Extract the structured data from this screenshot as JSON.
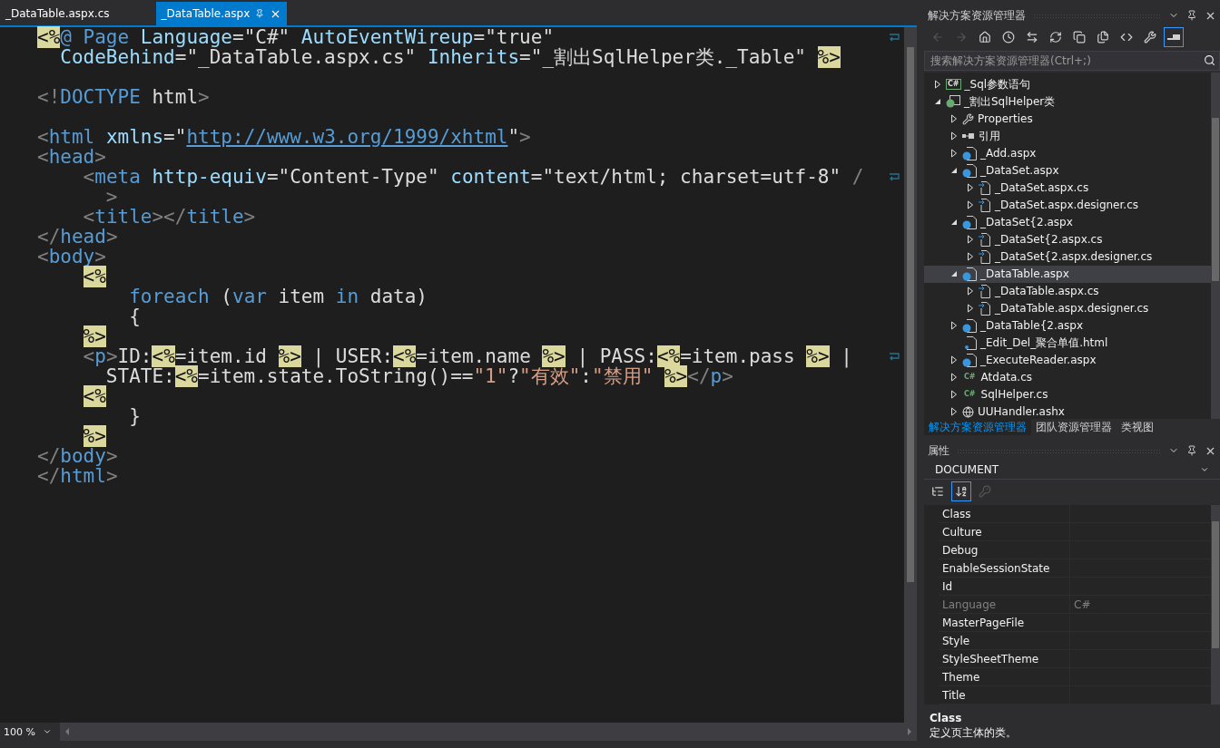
{
  "editor_tabs": [
    {
      "label": "_DataTable.aspx.cs",
      "selected": false
    },
    {
      "label": "_DataTable.aspx",
      "selected": true
    }
  ],
  "code_lines": [
    {
      "wrap": true,
      "tokens": [
        {
          "kind": "asp",
          "text": "<%"
        },
        {
          "kind": "tag",
          "text": "@ Page"
        },
        {
          "kind": "attr",
          "text": " Language"
        },
        {
          "kind": "plain",
          "text": "="
        },
        {
          "kind": "value",
          "text": "\"C#\""
        },
        {
          "kind": "attr",
          "text": " AutoEventWireup"
        },
        {
          "kind": "plain",
          "text": "="
        },
        {
          "kind": "value",
          "text": "\"true\""
        }
      ]
    },
    {
      "wrap": false,
      "tokens": [
        {
          "kind": "attr",
          "text": "  CodeBehind"
        },
        {
          "kind": "plain",
          "text": "="
        },
        {
          "kind": "value",
          "text": "\"_DataTable.aspx.cs\""
        },
        {
          "kind": "attr",
          "text": " Inherits"
        },
        {
          "kind": "plain",
          "text": "="
        },
        {
          "kind": "value",
          "text": "\"_割出SqlHelper类._Table\" "
        },
        {
          "kind": "asp",
          "text": "%>"
        }
      ]
    },
    {
      "wrap": false,
      "blank_before": true,
      "tokens": [
        {
          "kind": "punct",
          "text": "<!"
        },
        {
          "kind": "tag",
          "text": "DOCTYPE"
        },
        {
          "kind": "plain",
          "text": " html"
        },
        {
          "kind": "punct",
          "text": ">"
        }
      ]
    },
    {
      "wrap": false,
      "blank_before": true,
      "tokens": [
        {
          "kind": "punct",
          "text": "<"
        },
        {
          "kind": "tag",
          "text": "html"
        },
        {
          "kind": "attr",
          "text": " xmlns"
        },
        {
          "kind": "plain",
          "text": "="
        },
        {
          "kind": "value",
          "text": "\""
        },
        {
          "kind": "link",
          "text": "http://www.w3.org/1999/xhtml"
        },
        {
          "kind": "value",
          "text": "\""
        },
        {
          "kind": "punct",
          "text": ">"
        }
      ]
    },
    {
      "wrap": false,
      "tokens": [
        {
          "kind": "punct",
          "text": "<"
        },
        {
          "kind": "tag",
          "text": "head"
        },
        {
          "kind": "punct",
          "text": ">"
        }
      ]
    },
    {
      "wrap": true,
      "tokens": [
        {
          "kind": "punct",
          "text": "    <"
        },
        {
          "kind": "tag",
          "text": "meta"
        },
        {
          "kind": "attr",
          "text": " http-equiv"
        },
        {
          "kind": "plain",
          "text": "="
        },
        {
          "kind": "value",
          "text": "\"Content-Type\""
        },
        {
          "kind": "attr",
          "text": " content"
        },
        {
          "kind": "plain",
          "text": "="
        },
        {
          "kind": "value",
          "text": "\"text/html; charset=utf-8\""
        },
        {
          "kind": "punct",
          "text": " /"
        }
      ]
    },
    {
      "wrap": false,
      "tokens": [
        {
          "kind": "punct",
          "text": "      >"
        }
      ]
    },
    {
      "wrap": false,
      "tokens": [
        {
          "kind": "punct",
          "text": "    <"
        },
        {
          "kind": "tag",
          "text": "title"
        },
        {
          "kind": "punct",
          "text": "></"
        },
        {
          "kind": "tag",
          "text": "title"
        },
        {
          "kind": "punct",
          "text": ">"
        }
      ]
    },
    {
      "wrap": false,
      "tokens": [
        {
          "kind": "punct",
          "text": "</"
        },
        {
          "kind": "tag",
          "text": "head"
        },
        {
          "kind": "punct",
          "text": ">"
        }
      ]
    },
    {
      "wrap": false,
      "tokens": [
        {
          "kind": "punct",
          "text": "<"
        },
        {
          "kind": "tag",
          "text": "body"
        },
        {
          "kind": "punct",
          "text": ">"
        }
      ]
    },
    {
      "wrap": false,
      "tokens": [
        {
          "kind": "asp",
          "text": "    <%"
        }
      ]
    },
    {
      "wrap": false,
      "tokens": [
        {
          "kind": "keyword",
          "text": "        foreach"
        },
        {
          "kind": "plain",
          "text": " ("
        },
        {
          "kind": "keyword",
          "text": "var"
        },
        {
          "kind": "plain",
          "text": " item "
        },
        {
          "kind": "keyword",
          "text": "in"
        },
        {
          "kind": "plain",
          "text": " data)"
        }
      ]
    },
    {
      "wrap": false,
      "tokens": [
        {
          "kind": "plain",
          "text": "        {"
        }
      ]
    },
    {
      "wrap": false,
      "tokens": [
        {
          "kind": "asp",
          "text": "    %>"
        }
      ]
    },
    {
      "wrap": true,
      "tokens": [
        {
          "kind": "punct",
          "text": "    <"
        },
        {
          "kind": "tag",
          "text": "p"
        },
        {
          "kind": "punct",
          "text": ">"
        },
        {
          "kind": "plain",
          "text": "ID:"
        },
        {
          "kind": "asp",
          "text": "<%"
        },
        {
          "kind": "plain",
          "text": "=item.id "
        },
        {
          "kind": "asp",
          "text": "%>"
        },
        {
          "kind": "plain",
          "text": " | USER:"
        },
        {
          "kind": "asp",
          "text": "<%"
        },
        {
          "kind": "plain",
          "text": "=item.name "
        },
        {
          "kind": "asp",
          "text": "%>"
        },
        {
          "kind": "plain",
          "text": " | PASS:"
        },
        {
          "kind": "asp",
          "text": "<%"
        },
        {
          "kind": "plain",
          "text": "=item.pass "
        },
        {
          "kind": "asp",
          "text": "%>"
        },
        {
          "kind": "plain",
          "text": " |"
        }
      ]
    },
    {
      "wrap": false,
      "tokens": [
        {
          "kind": "plain",
          "text": "      STATE:"
        },
        {
          "kind": "asp",
          "text": "<%"
        },
        {
          "kind": "plain",
          "text": "=item.state.ToString()=="
        },
        {
          "kind": "string",
          "text": "\"1\""
        },
        {
          "kind": "plain",
          "text": "?"
        },
        {
          "kind": "string",
          "text": "\"有效\""
        },
        {
          "kind": "plain",
          "text": ":"
        },
        {
          "kind": "string",
          "text": "\"禁用\" "
        },
        {
          "kind": "asp",
          "text": "%>"
        },
        {
          "kind": "punct",
          "text": "</"
        },
        {
          "kind": "tag",
          "text": "p"
        },
        {
          "kind": "punct",
          "text": ">"
        }
      ]
    },
    {
      "wrap": false,
      "tokens": [
        {
          "kind": "asp",
          "text": "    <%"
        }
      ]
    },
    {
      "wrap": false,
      "tokens": [
        {
          "kind": "plain",
          "text": "        }"
        }
      ]
    },
    {
      "wrap": false,
      "tokens": [
        {
          "kind": "asp",
          "text": "    %>"
        }
      ]
    },
    {
      "wrap": false,
      "tokens": [
        {
          "kind": "punct",
          "text": "</"
        },
        {
          "kind": "tag",
          "text": "body"
        },
        {
          "kind": "punct",
          "text": ">"
        }
      ]
    },
    {
      "wrap": false,
      "tokens": [
        {
          "kind": "punct",
          "text": "</"
        },
        {
          "kind": "tag",
          "text": "html"
        },
        {
          "kind": "punct",
          "text": ">"
        }
      ]
    }
  ],
  "zoom": {
    "value": "100 %"
  },
  "solution_explorer": {
    "title": "解决方案资源管理器",
    "toolbar": [
      {
        "kind": "back",
        "selected": false
      },
      {
        "kind": "forward",
        "selected": false
      },
      {
        "kind": "home",
        "selected": false
      },
      {
        "kind": "history",
        "selected": false
      },
      {
        "kind": "sync",
        "selected": false
      },
      {
        "kind": "refresh",
        "selected": false
      },
      {
        "kind": "collapse",
        "selected": false
      },
      {
        "kind": "files",
        "selected": false
      },
      {
        "kind": "code",
        "selected": false
      },
      {
        "kind": "wrench",
        "selected": false
      },
      {
        "kind": "preview",
        "selected": true
      }
    ],
    "search": {
      "placeholder": "搜索解决方案资源管理器(Ctrl+;)"
    },
    "tree": [
      {
        "label": "_Sql参数语句",
        "kind": "csproject",
        "badge": "C#",
        "expanded": false,
        "selected": false
      },
      {
        "label": "_割出SqlHelper类",
        "kind": "webproject",
        "expanded": true,
        "selected": false,
        "children": [
          {
            "label": "Properties",
            "kind": "wrench",
            "expanded": false,
            "selected": false
          },
          {
            "label": "引用",
            "kind": "reference",
            "expanded": false,
            "selected": false
          },
          {
            "label": "_Add.aspx",
            "kind": "webform",
            "expanded": false,
            "selected": false
          },
          {
            "label": "_DataSet.aspx",
            "kind": "webform",
            "expanded": true,
            "selected": false,
            "children": [
              {
                "label": "_DataSet.aspx.cs",
                "kind": "codefile",
                "expanded": false,
                "selected": false
              },
              {
                "label": "_DataSet.aspx.designer.cs",
                "kind": "codefile",
                "expanded": false,
                "selected": false
              }
            ]
          },
          {
            "label": "_DataSet{2.aspx",
            "kind": "webform",
            "expanded": true,
            "selected": false,
            "children": [
              {
                "label": "_DataSet{2.aspx.cs",
                "kind": "codefile",
                "expanded": false,
                "selected": false
              },
              {
                "label": "_DataSet{2.aspx.designer.cs",
                "kind": "codefile",
                "expanded": false,
                "selected": false
              }
            ]
          },
          {
            "label": "_DataTable.aspx",
            "kind": "webform",
            "expanded": true,
            "selected": true,
            "children": [
              {
                "label": "_DataTable.aspx.cs",
                "kind": "codefile",
                "expanded": false,
                "selected": false
              },
              {
                "label": "_DataTable.aspx.designer.cs",
                "kind": "codefile",
                "expanded": false,
                "selected": false
              }
            ]
          },
          {
            "label": "_DataTable{2.aspx",
            "kind": "webform",
            "expanded": false,
            "selected": false
          },
          {
            "label": "_Edit_Del_聚合单值.html",
            "kind": "html",
            "selected": false
          },
          {
            "label": "_ExecuteReader.aspx",
            "kind": "webform",
            "expanded": false,
            "selected": false
          },
          {
            "label": "Atdata.cs",
            "kind": "cs",
            "badge": "C#",
            "expanded": false,
            "selected": false
          },
          {
            "label": "SqlHelper.cs",
            "kind": "cs",
            "badge": "C#",
            "expanded": false,
            "selected": false
          },
          {
            "label": "UUHandler.ashx",
            "kind": "handler",
            "expanded": false,
            "selected": false
          }
        ]
      }
    ],
    "tabs": [
      {
        "label": "解决方案资源管理器",
        "selected": true
      },
      {
        "label": "团队资源管理器",
        "selected": false
      },
      {
        "label": "类视图",
        "selected": false
      }
    ]
  },
  "properties": {
    "title": "属性",
    "object": "DOCUMENT",
    "toolbar": [
      {
        "kind": "categorized",
        "selected": false,
        "disabled": false
      },
      {
        "kind": "alphabetical",
        "selected": true,
        "disabled": false
      },
      {
        "kind": "pages",
        "selected": false,
        "disabled": true
      }
    ],
    "rows": [
      {
        "name": "Class",
        "disabled": false
      },
      {
        "name": "Culture",
        "disabled": false
      },
      {
        "name": "Debug",
        "disabled": false
      },
      {
        "name": "EnableSessionState",
        "disabled": false
      },
      {
        "name": "Id",
        "disabled": false
      },
      {
        "name": "Language",
        "value": "C#",
        "disabled": true
      },
      {
        "name": "MasterPageFile",
        "disabled": false
      },
      {
        "name": "Style",
        "disabled": false
      },
      {
        "name": "StyleSheetTheme",
        "disabled": false
      },
      {
        "name": "Theme",
        "disabled": false
      },
      {
        "name": "Title",
        "disabled": false
      }
    ],
    "description": {
      "title": "Class",
      "text": "定义页主体的类。"
    }
  }
}
